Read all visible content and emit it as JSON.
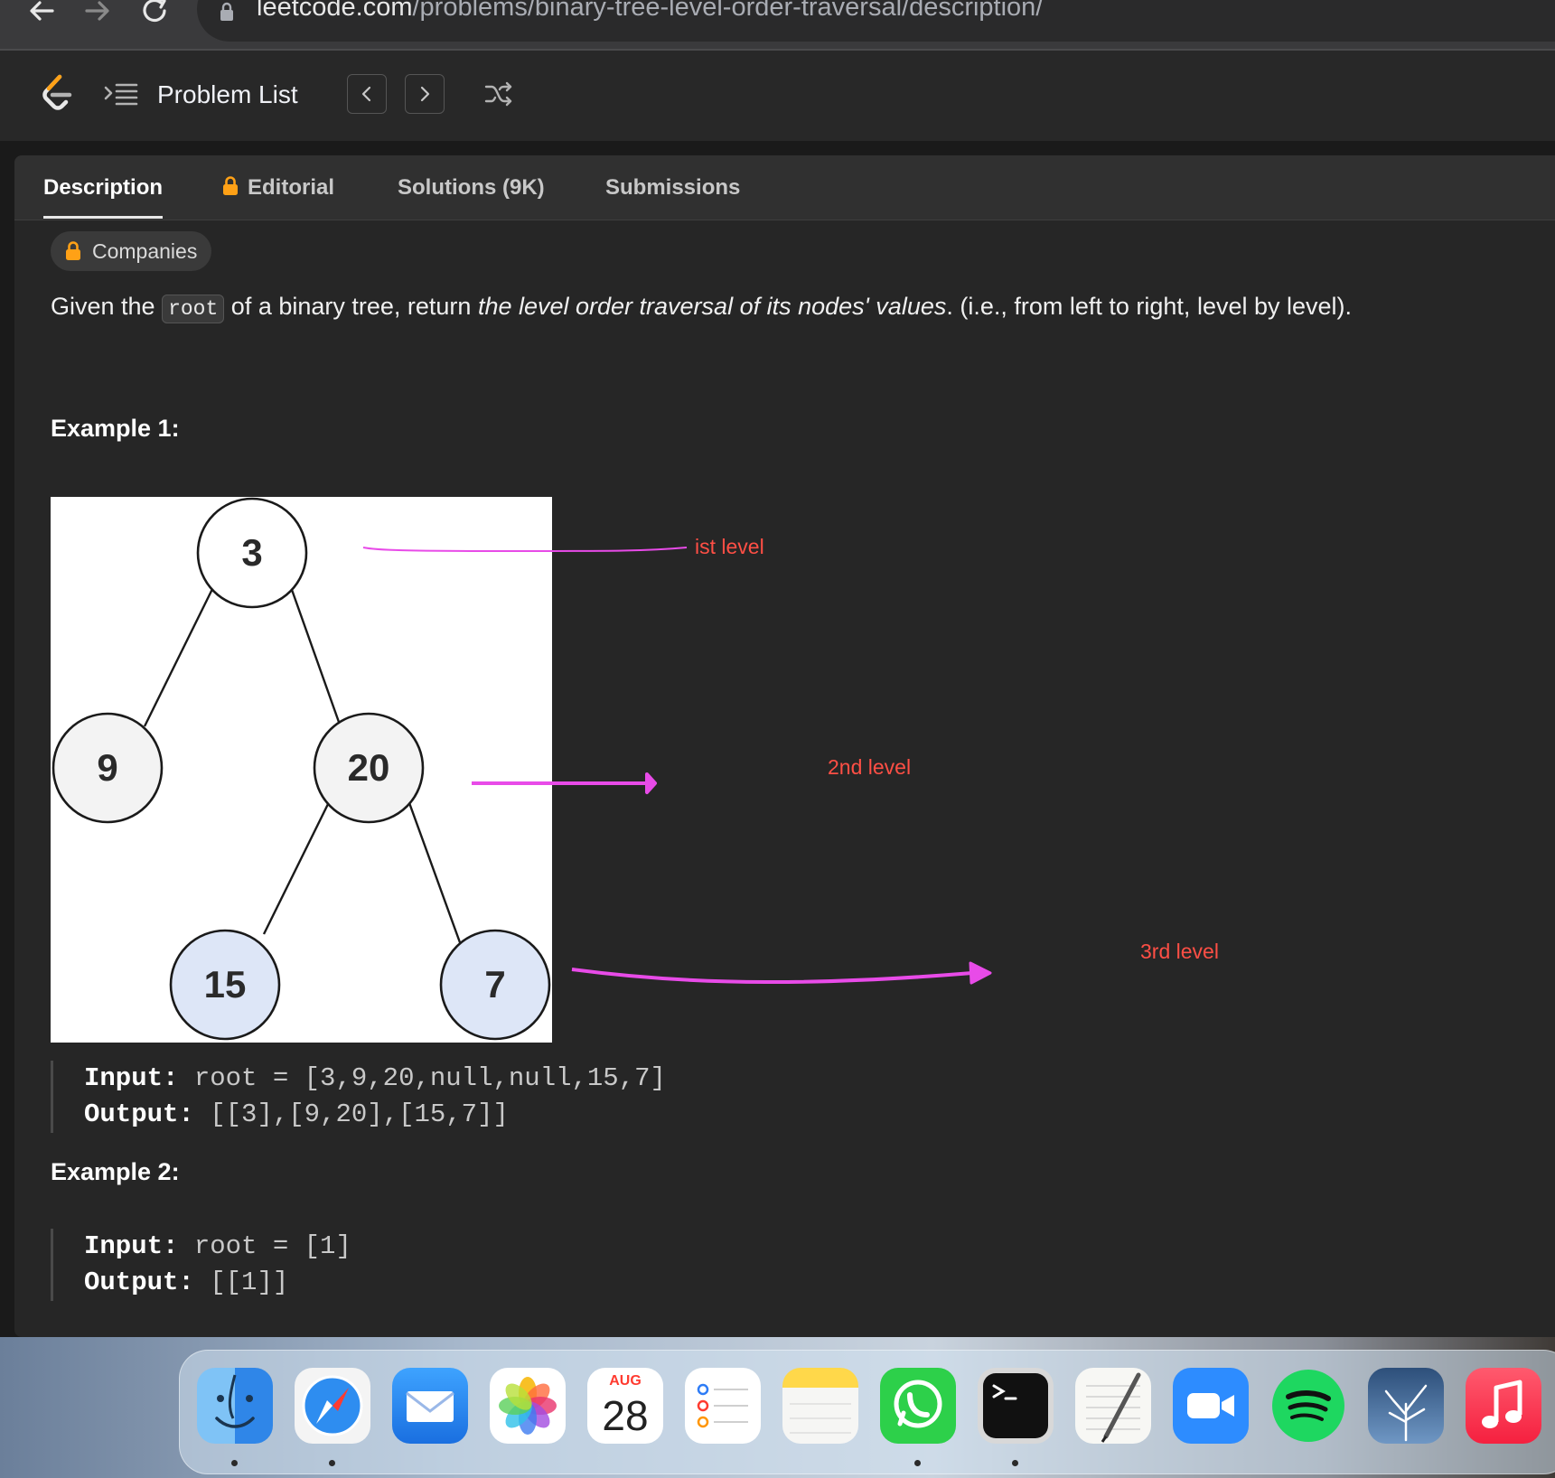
{
  "browser": {
    "url_host": "leetcode.com",
    "url_path": "/problems/binary-tree-level-order-traversal/description/"
  },
  "header": {
    "problem_list_label": "Problem List"
  },
  "tabs": [
    {
      "label": "Description"
    },
    {
      "label": "Editorial"
    },
    {
      "label": "Solutions (9K)"
    },
    {
      "label": "Submissions"
    }
  ],
  "companies_label": "Companies",
  "description": {
    "prefix": "Given the ",
    "code": "root",
    "middle": " of a binary tree, return ",
    "emphasis": "the level order traversal of its nodes' values",
    "suffix": ". (i.e., from left to right, level by level)."
  },
  "examples": [
    {
      "title": "Example 1:",
      "input_label": "Input:",
      "input_value": "root = [3,9,20,null,null,15,7]",
      "output_label": "Output:",
      "output_value": "[[3],[9,20],[15,7]]"
    },
    {
      "title": "Example 2:",
      "input_label": "Input:",
      "input_value": "root = [1]",
      "output_label": "Output:",
      "output_value": "[[1]]"
    }
  ],
  "tree_nodes": {
    "root": "3",
    "left": "9",
    "right": "20",
    "right_left": "15",
    "right_right": "7"
  },
  "annotations": {
    "level1": "ist level",
    "level2": "2nd level",
    "level3": "3rd level"
  },
  "dock": {
    "calendar_month": "AUG",
    "calendar_day": "28",
    "apps": [
      "finder-icon",
      "safari-icon",
      "mail-icon",
      "photos-icon",
      "calendar-icon",
      "reminders-icon",
      "notes-icon",
      "whatsapp-icon",
      "terminal-icon",
      "textedit-icon",
      "zoom-icon",
      "spotify-icon",
      "preview-icon",
      "music-icon"
    ]
  },
  "colors": {
    "accent_lock": "#ffa116",
    "annotation_text": "#ff4f45",
    "annotation_arrow": "#e84be8",
    "leaf_fill": "#dde6f7"
  }
}
